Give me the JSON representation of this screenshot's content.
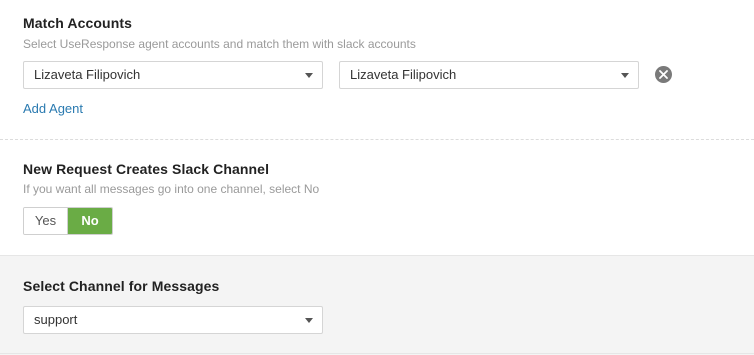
{
  "match_accounts": {
    "title": "Match Accounts",
    "subtitle": "Select UseResponse agent accounts and match them with slack accounts",
    "agent_select_value": "Lizaveta Filipovich",
    "slack_select_value": "Lizaveta Filipovich",
    "remove_icon": "close-circle-icon",
    "add_agent_label": "Add Agent"
  },
  "new_request": {
    "title": "New Request Creates Slack Channel",
    "subtitle": "If you want all messages go into one channel, select No",
    "yes_label": "Yes",
    "no_label": "No",
    "selected": "No"
  },
  "channel": {
    "title": "Select Channel for Messages",
    "select_value": "support"
  },
  "colors": {
    "accent_green": "#6aac45",
    "link_blue": "#2a7ab0"
  }
}
